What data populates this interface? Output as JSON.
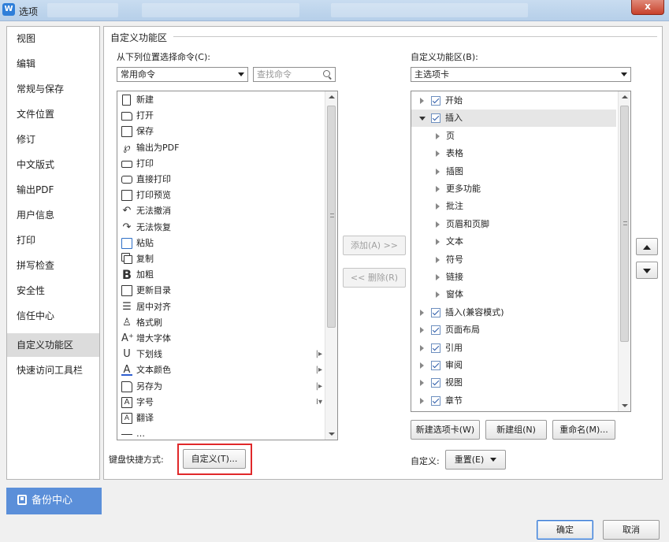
{
  "window": {
    "app_icon": "W",
    "title": "选项",
    "close_glyph": "x"
  },
  "sidebar": {
    "items": [
      {
        "label": "视图"
      },
      {
        "label": "编辑"
      },
      {
        "label": "常规与保存"
      },
      {
        "label": "文件位置"
      },
      {
        "label": "修订"
      },
      {
        "label": "中文版式"
      },
      {
        "label": "输出PDF"
      },
      {
        "label": "用户信息"
      },
      {
        "label": "打印"
      },
      {
        "label": "拼写检查"
      },
      {
        "label": "安全性"
      },
      {
        "label": "信任中心"
      },
      {
        "label": "自定义功能区",
        "active": true
      },
      {
        "label": "快速访问工具栏"
      }
    ]
  },
  "backup_button": {
    "label": "备份中心",
    "icon": "backup-icon",
    "color": "#5b8fd9"
  },
  "main": {
    "group_title": "自定义功能区",
    "left": {
      "choose_label": "从下列位置选择命令(C):",
      "choose_value": "常用命令",
      "search_placeholder": "查找命令",
      "commands": [
        {
          "label": "新建",
          "icon": "new-doc-icon"
        },
        {
          "label": "打开",
          "icon": "folder-open-icon"
        },
        {
          "label": "保存",
          "icon": "save-icon"
        },
        {
          "label": "输出为PDF",
          "icon": "pdf-icon"
        },
        {
          "label": "打印",
          "icon": "printer-icon"
        },
        {
          "label": "直接打印",
          "icon": "direct-print-icon"
        },
        {
          "label": "打印预览",
          "icon": "print-preview-icon"
        },
        {
          "label": "无法撤消",
          "icon": "undo-icon"
        },
        {
          "label": "无法恢复",
          "icon": "redo-icon"
        },
        {
          "label": "粘贴",
          "icon": "paste-icon"
        },
        {
          "label": "复制",
          "icon": "copy-icon"
        },
        {
          "label": "加粗",
          "icon": "bold-icon"
        },
        {
          "label": "更新目录",
          "icon": "update-toc-icon"
        },
        {
          "label": "居中对齐",
          "icon": "align-center-icon"
        },
        {
          "label": "格式刷",
          "icon": "format-painter-icon"
        },
        {
          "label": "增大字体",
          "icon": "font-grow-icon"
        },
        {
          "label": "下划线",
          "icon": "underline-icon",
          "sub": "|▸"
        },
        {
          "label": "文本颜色",
          "icon": "font-color-icon",
          "sub": "|▸"
        },
        {
          "label": "另存为",
          "icon": "save-as-icon",
          "sub": "|▸"
        },
        {
          "label": "字号",
          "icon": "font-size-icon",
          "sub": "I▾"
        },
        {
          "label": "翻译",
          "icon": "translate-icon"
        },
        {
          "label": "…",
          "icon": "more-icon"
        }
      ],
      "shortcut_label": "键盘快捷方式:",
      "customize_button": "自定义(T)..."
    },
    "center": {
      "add_button": "添加(A) >>",
      "remove_button": "<< 删除(R)"
    },
    "right": {
      "ribbon_label": "自定义功能区(B):",
      "ribbon_value": "主选项卡",
      "tree": [
        {
          "label": "开始",
          "level": 0,
          "checked": true,
          "expanded": false
        },
        {
          "label": "插入",
          "level": 0,
          "checked": true,
          "expanded": true,
          "selected": true
        },
        {
          "label": "页",
          "level": 1
        },
        {
          "label": "表格",
          "level": 1
        },
        {
          "label": "插图",
          "level": 1
        },
        {
          "label": "更多功能",
          "level": 1
        },
        {
          "label": "批注",
          "level": 1
        },
        {
          "label": "页眉和页脚",
          "level": 1
        },
        {
          "label": "文本",
          "level": 1
        },
        {
          "label": "符号",
          "level": 1
        },
        {
          "label": "链接",
          "level": 1
        },
        {
          "label": "窗体",
          "level": 1
        },
        {
          "label": "插入(兼容模式)",
          "level": 0,
          "checked": true,
          "expanded": false
        },
        {
          "label": "页面布局",
          "level": 0,
          "checked": true,
          "expanded": false
        },
        {
          "label": "引用",
          "level": 0,
          "checked": true,
          "expanded": false
        },
        {
          "label": "审阅",
          "level": 0,
          "checked": true,
          "expanded": false
        },
        {
          "label": "视图",
          "level": 0,
          "checked": true,
          "expanded": false
        },
        {
          "label": "章节",
          "level": 0,
          "checked": true,
          "expanded": false
        }
      ],
      "new_tab_button": "新建选项卡(W)",
      "new_group_button": "新建组(N)",
      "rename_button": "重命名(M)...",
      "customize_label": "自定义:",
      "reset_button": "重置(E)"
    }
  },
  "footer": {
    "ok_button": "确定",
    "cancel_button": "取消"
  },
  "colors": {
    "highlight_frame": "#e0282a",
    "accent": "#3b7bd4"
  }
}
